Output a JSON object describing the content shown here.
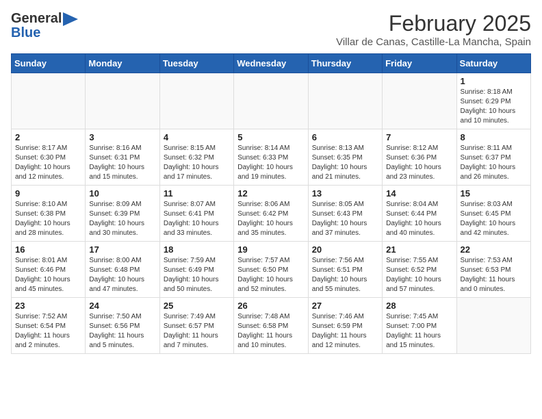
{
  "header": {
    "logo_general": "General",
    "logo_blue": "Blue",
    "month_title": "February 2025",
    "location": "Villar de Canas, Castille-La Mancha, Spain"
  },
  "weekdays": [
    "Sunday",
    "Monday",
    "Tuesday",
    "Wednesday",
    "Thursday",
    "Friday",
    "Saturday"
  ],
  "weeks": [
    [
      {
        "day": "",
        "info": ""
      },
      {
        "day": "",
        "info": ""
      },
      {
        "day": "",
        "info": ""
      },
      {
        "day": "",
        "info": ""
      },
      {
        "day": "",
        "info": ""
      },
      {
        "day": "",
        "info": ""
      },
      {
        "day": "1",
        "info": "Sunrise: 8:18 AM\nSunset: 6:29 PM\nDaylight: 10 hours\nand 10 minutes."
      }
    ],
    [
      {
        "day": "2",
        "info": "Sunrise: 8:17 AM\nSunset: 6:30 PM\nDaylight: 10 hours\nand 12 minutes."
      },
      {
        "day": "3",
        "info": "Sunrise: 8:16 AM\nSunset: 6:31 PM\nDaylight: 10 hours\nand 15 minutes."
      },
      {
        "day": "4",
        "info": "Sunrise: 8:15 AM\nSunset: 6:32 PM\nDaylight: 10 hours\nand 17 minutes."
      },
      {
        "day": "5",
        "info": "Sunrise: 8:14 AM\nSunset: 6:33 PM\nDaylight: 10 hours\nand 19 minutes."
      },
      {
        "day": "6",
        "info": "Sunrise: 8:13 AM\nSunset: 6:35 PM\nDaylight: 10 hours\nand 21 minutes."
      },
      {
        "day": "7",
        "info": "Sunrise: 8:12 AM\nSunset: 6:36 PM\nDaylight: 10 hours\nand 23 minutes."
      },
      {
        "day": "8",
        "info": "Sunrise: 8:11 AM\nSunset: 6:37 PM\nDaylight: 10 hours\nand 26 minutes."
      }
    ],
    [
      {
        "day": "9",
        "info": "Sunrise: 8:10 AM\nSunset: 6:38 PM\nDaylight: 10 hours\nand 28 minutes."
      },
      {
        "day": "10",
        "info": "Sunrise: 8:09 AM\nSunset: 6:39 PM\nDaylight: 10 hours\nand 30 minutes."
      },
      {
        "day": "11",
        "info": "Sunrise: 8:07 AM\nSunset: 6:41 PM\nDaylight: 10 hours\nand 33 minutes."
      },
      {
        "day": "12",
        "info": "Sunrise: 8:06 AM\nSunset: 6:42 PM\nDaylight: 10 hours\nand 35 minutes."
      },
      {
        "day": "13",
        "info": "Sunrise: 8:05 AM\nSunset: 6:43 PM\nDaylight: 10 hours\nand 37 minutes."
      },
      {
        "day": "14",
        "info": "Sunrise: 8:04 AM\nSunset: 6:44 PM\nDaylight: 10 hours\nand 40 minutes."
      },
      {
        "day": "15",
        "info": "Sunrise: 8:03 AM\nSunset: 6:45 PM\nDaylight: 10 hours\nand 42 minutes."
      }
    ],
    [
      {
        "day": "16",
        "info": "Sunrise: 8:01 AM\nSunset: 6:46 PM\nDaylight: 10 hours\nand 45 minutes."
      },
      {
        "day": "17",
        "info": "Sunrise: 8:00 AM\nSunset: 6:48 PM\nDaylight: 10 hours\nand 47 minutes."
      },
      {
        "day": "18",
        "info": "Sunrise: 7:59 AM\nSunset: 6:49 PM\nDaylight: 10 hours\nand 50 minutes."
      },
      {
        "day": "19",
        "info": "Sunrise: 7:57 AM\nSunset: 6:50 PM\nDaylight: 10 hours\nand 52 minutes."
      },
      {
        "day": "20",
        "info": "Sunrise: 7:56 AM\nSunset: 6:51 PM\nDaylight: 10 hours\nand 55 minutes."
      },
      {
        "day": "21",
        "info": "Sunrise: 7:55 AM\nSunset: 6:52 PM\nDaylight: 10 hours\nand 57 minutes."
      },
      {
        "day": "22",
        "info": "Sunrise: 7:53 AM\nSunset: 6:53 PM\nDaylight: 11 hours\nand 0 minutes."
      }
    ],
    [
      {
        "day": "23",
        "info": "Sunrise: 7:52 AM\nSunset: 6:54 PM\nDaylight: 11 hours\nand 2 minutes."
      },
      {
        "day": "24",
        "info": "Sunrise: 7:50 AM\nSunset: 6:56 PM\nDaylight: 11 hours\nand 5 minutes."
      },
      {
        "day": "25",
        "info": "Sunrise: 7:49 AM\nSunset: 6:57 PM\nDaylight: 11 hours\nand 7 minutes."
      },
      {
        "day": "26",
        "info": "Sunrise: 7:48 AM\nSunset: 6:58 PM\nDaylight: 11 hours\nand 10 minutes."
      },
      {
        "day": "27",
        "info": "Sunrise: 7:46 AM\nSunset: 6:59 PM\nDaylight: 11 hours\nand 12 minutes."
      },
      {
        "day": "28",
        "info": "Sunrise: 7:45 AM\nSunset: 7:00 PM\nDaylight: 11 hours\nand 15 minutes."
      },
      {
        "day": "",
        "info": ""
      }
    ]
  ]
}
